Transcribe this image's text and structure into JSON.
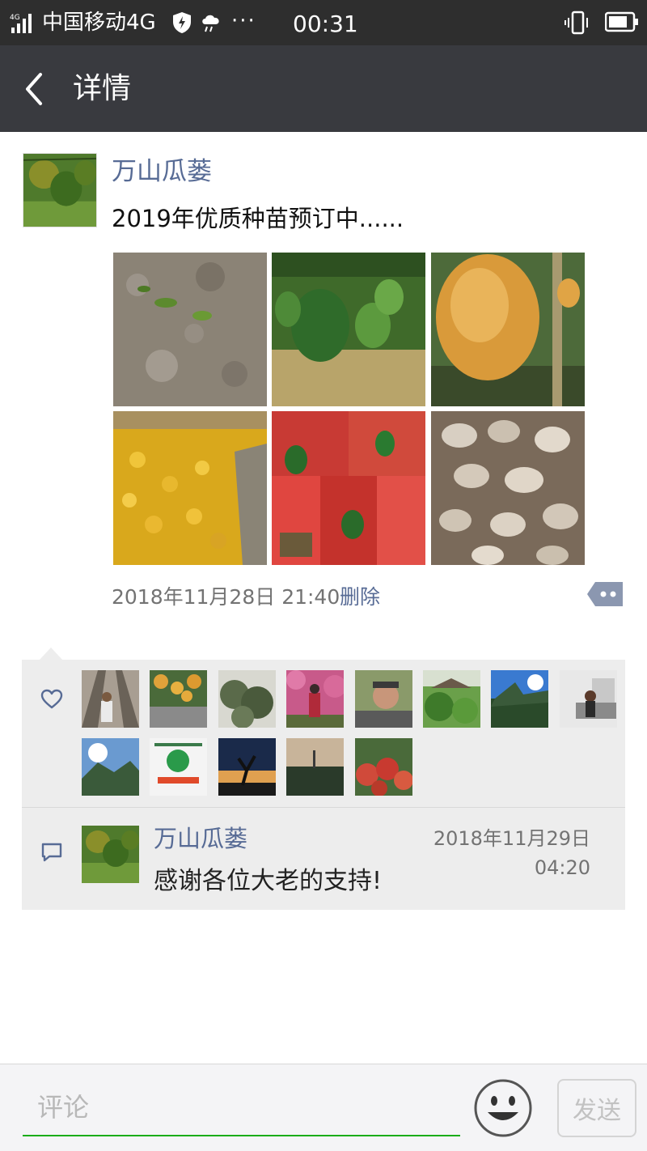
{
  "status_bar": {
    "carrier": "中国移动4G",
    "more": "···",
    "time": "00:31"
  },
  "nav": {
    "title": "详情"
  },
  "post": {
    "author": "万山瓜蒌",
    "text": "2019年优质种苗预订中......",
    "time": "2018年11月28日 21:40",
    "delete_label": "删除",
    "photos": [
      "seedling-soil-photo",
      "green-gourds-on-vine-photo",
      "ripe-golden-gourd-photo",
      "golden-gourd-harvest-pile-photo",
      "packaged-seeds-photo",
      "gourd-seeds-closeup-photo"
    ]
  },
  "likes": {
    "icon": "heart-outline-icon",
    "count_shown": 13
  },
  "comments": [
    {
      "author": "万山瓜蒌",
      "time": "2018年11月29日 04:20",
      "text": "感谢各位大老的支持!"
    }
  ],
  "input_bar": {
    "placeholder": "评论",
    "send_label": "发送"
  },
  "colors": {
    "status_bar_bg": "#2e2e2e",
    "nav_bg": "#393a3f",
    "name_link": "#576b95",
    "panel_bg": "#ededed",
    "input_underline": "#1aad19"
  }
}
